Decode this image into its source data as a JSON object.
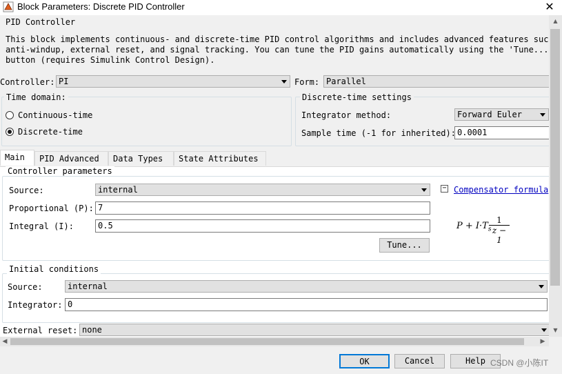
{
  "window": {
    "title": "Block Parameters: Discrete PID Controller"
  },
  "block": {
    "name": "PID Controller",
    "description_lines": [
      "This block implements continuous- and discrete-time PID control algorithms and includes advanced features such as",
      "anti-windup, external reset, and signal tracking. You can tune the PID gains automatically using the 'Tune...'",
      "button (requires Simulink Control Design)."
    ]
  },
  "controller": {
    "label": "Controller:",
    "value": "PI"
  },
  "form": {
    "label": "Form:",
    "value": "Parallel"
  },
  "time_domain": {
    "label": "Time domain:",
    "options": [
      "Continuous-time",
      "Discrete-time"
    ],
    "selected": "Discrete-time"
  },
  "discrete_settings": {
    "label": "Discrete-time settings",
    "integrator_method_label": "Integrator method:",
    "integrator_method_value": "Forward Euler",
    "sample_time_label": "Sample time (-1 for inherited):",
    "sample_time_value": "0.0001"
  },
  "tabs": [
    "Main",
    "PID Advanced",
    "Data Types",
    "State Attributes"
  ],
  "active_tab": "Main",
  "controller_params": {
    "label": "Controller parameters",
    "source_label": "Source:",
    "source_value": "internal",
    "p_label": "Proportional (P):",
    "p_value": "7",
    "i_label": "Integral (I):",
    "i_value": "0.5",
    "tune_label": "Tune...",
    "formula_toggle": "−",
    "formula_link": "Compensator formula",
    "formula_text": {
      "lhs": "P + I·T",
      "sub": "s",
      "num": "1",
      "den": "z − 1"
    }
  },
  "initial_conditions": {
    "label": "Initial conditions",
    "source_label": "Source:",
    "source_value": "internal",
    "integrator_label": "Integrator:",
    "integrator_value": "0"
  },
  "external_reset": {
    "label": "External reset:",
    "value": "none"
  },
  "buttons": {
    "ok": "OK",
    "cancel": "Cancel",
    "help": "Help"
  },
  "watermark": "CSDN @小陈IT",
  "icons": {
    "app": "simulink-block-icon",
    "close": "close-icon"
  }
}
